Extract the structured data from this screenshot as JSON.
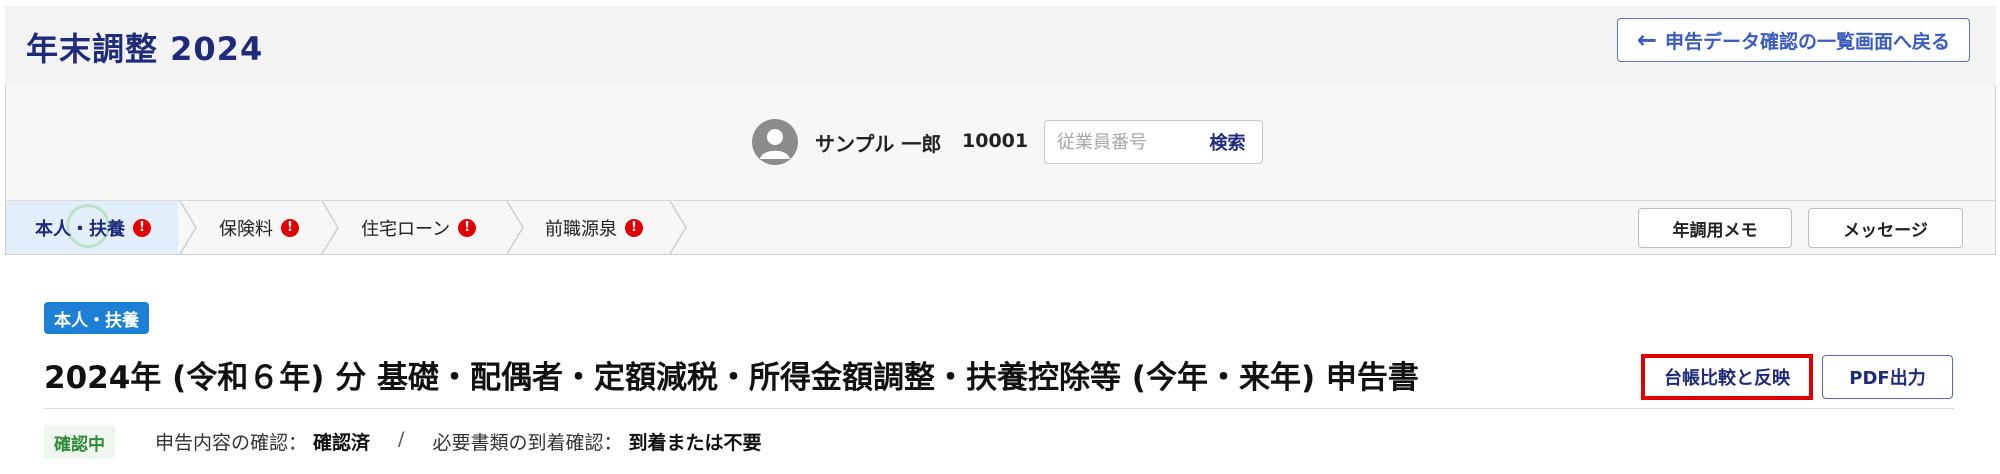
{
  "header": {
    "app_title": "年末調整 2024",
    "back_label": "申告データ確認の一覧画面へ戻る"
  },
  "user": {
    "name": "サンプル 一郎",
    "employee_id": "10001",
    "search_placeholder": "従業員番号",
    "search_button": "検索"
  },
  "steps": [
    {
      "label": "本人・扶養",
      "error": "!",
      "active": true
    },
    {
      "label": "保険料",
      "error": "!"
    },
    {
      "label": "住宅ローン",
      "error": "!"
    },
    {
      "label": "前職源泉",
      "error": "!"
    }
  ],
  "toolbar": {
    "memo_label": "年調用メモ",
    "message_label": "メッセージ"
  },
  "section": {
    "tag": "本人・扶養",
    "title": "2024年 (令和６年) 分 基礎・配偶者・定額減税・所得金額調整・扶養控除等 (今年・来年) 申告書",
    "ledger_button": "台帳比較と反映",
    "pdf_button": "PDF出力"
  },
  "status": {
    "badge": "確認中",
    "content_label": "申告内容の確認：",
    "content_value": "確認済",
    "separator": "/",
    "docs_label": "必要書類の到着確認：",
    "docs_value": "到着または不要"
  },
  "colors": {
    "brand": "#1f2b7a",
    "accent": "#1e7fd6",
    "error": "#e00000",
    "status_green": "#2f8a3a"
  }
}
